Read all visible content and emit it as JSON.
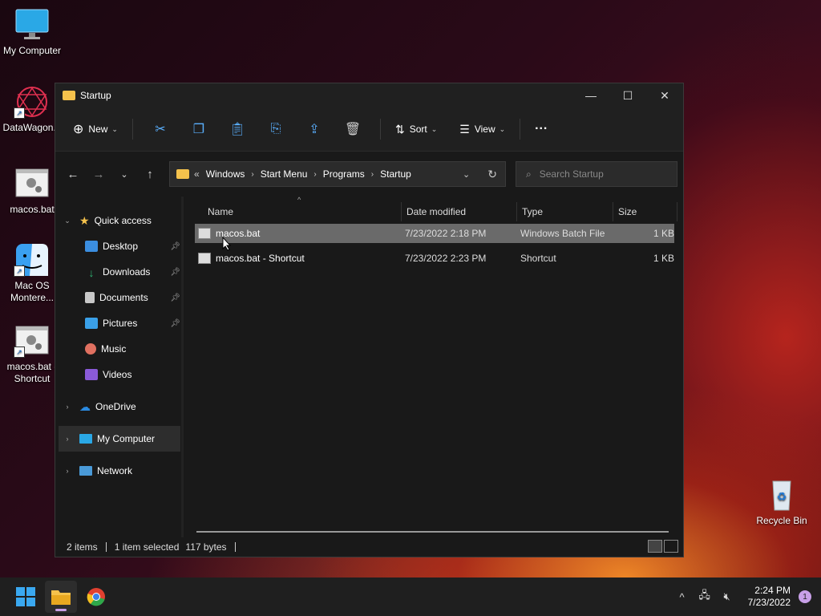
{
  "desktop": {
    "icons": [
      {
        "label": "My Computer"
      },
      {
        "label": "DataWagon..."
      },
      {
        "label": "macos.bat"
      },
      {
        "label": "Mac OS Montere..."
      },
      {
        "label": "macos.bat - Shortcut"
      },
      {
        "label": "Recycle Bin"
      }
    ]
  },
  "window": {
    "title": "Startup",
    "controls": {
      "minimize": "—",
      "maximize": "☐",
      "close": "✕"
    }
  },
  "toolbar": {
    "new_label": "New",
    "sort_label": "Sort",
    "view_label": "View",
    "more_label": "···",
    "icons": [
      "cut-icon",
      "copy-icon",
      "paste-icon",
      "rename-icon",
      "share-icon",
      "delete-icon"
    ]
  },
  "address": {
    "overflow": "«",
    "crumbs": [
      "Windows",
      "Start Menu",
      "Programs",
      "Startup"
    ],
    "search_placeholder": "Search Startup"
  },
  "sidebar": {
    "quick_access": "Quick access",
    "pinned": [
      {
        "label": "Desktop",
        "color": "#3b8ee0"
      },
      {
        "label": "Downloads",
        "color": "#2fb574"
      },
      {
        "label": "Documents",
        "color": "#c8c8c8"
      },
      {
        "label": "Pictures",
        "color": "#3aa0e8"
      },
      {
        "label": "Music",
        "color": "#e07060"
      },
      {
        "label": "Videos",
        "color": "#8a5ad8"
      }
    ],
    "onedrive": "OneDrive",
    "mycomputer": "My Computer",
    "network": "Network"
  },
  "columns": {
    "name": "Name",
    "date": "Date modified",
    "type": "Type",
    "size": "Size"
  },
  "files": [
    {
      "name": "macos.bat",
      "date": "7/23/2022 2:18 PM",
      "type": "Windows Batch File",
      "size": "1 KB"
    },
    {
      "name": "macos.bat - Shortcut",
      "date": "7/23/2022 2:23 PM",
      "type": "Shortcut",
      "size": "1 KB"
    }
  ],
  "status": {
    "items": "2 items",
    "selected": "1 item selected",
    "size": "117 bytes"
  },
  "taskbar": {
    "time": "2:24 PM",
    "date": "7/23/2022",
    "notifications": "1"
  }
}
